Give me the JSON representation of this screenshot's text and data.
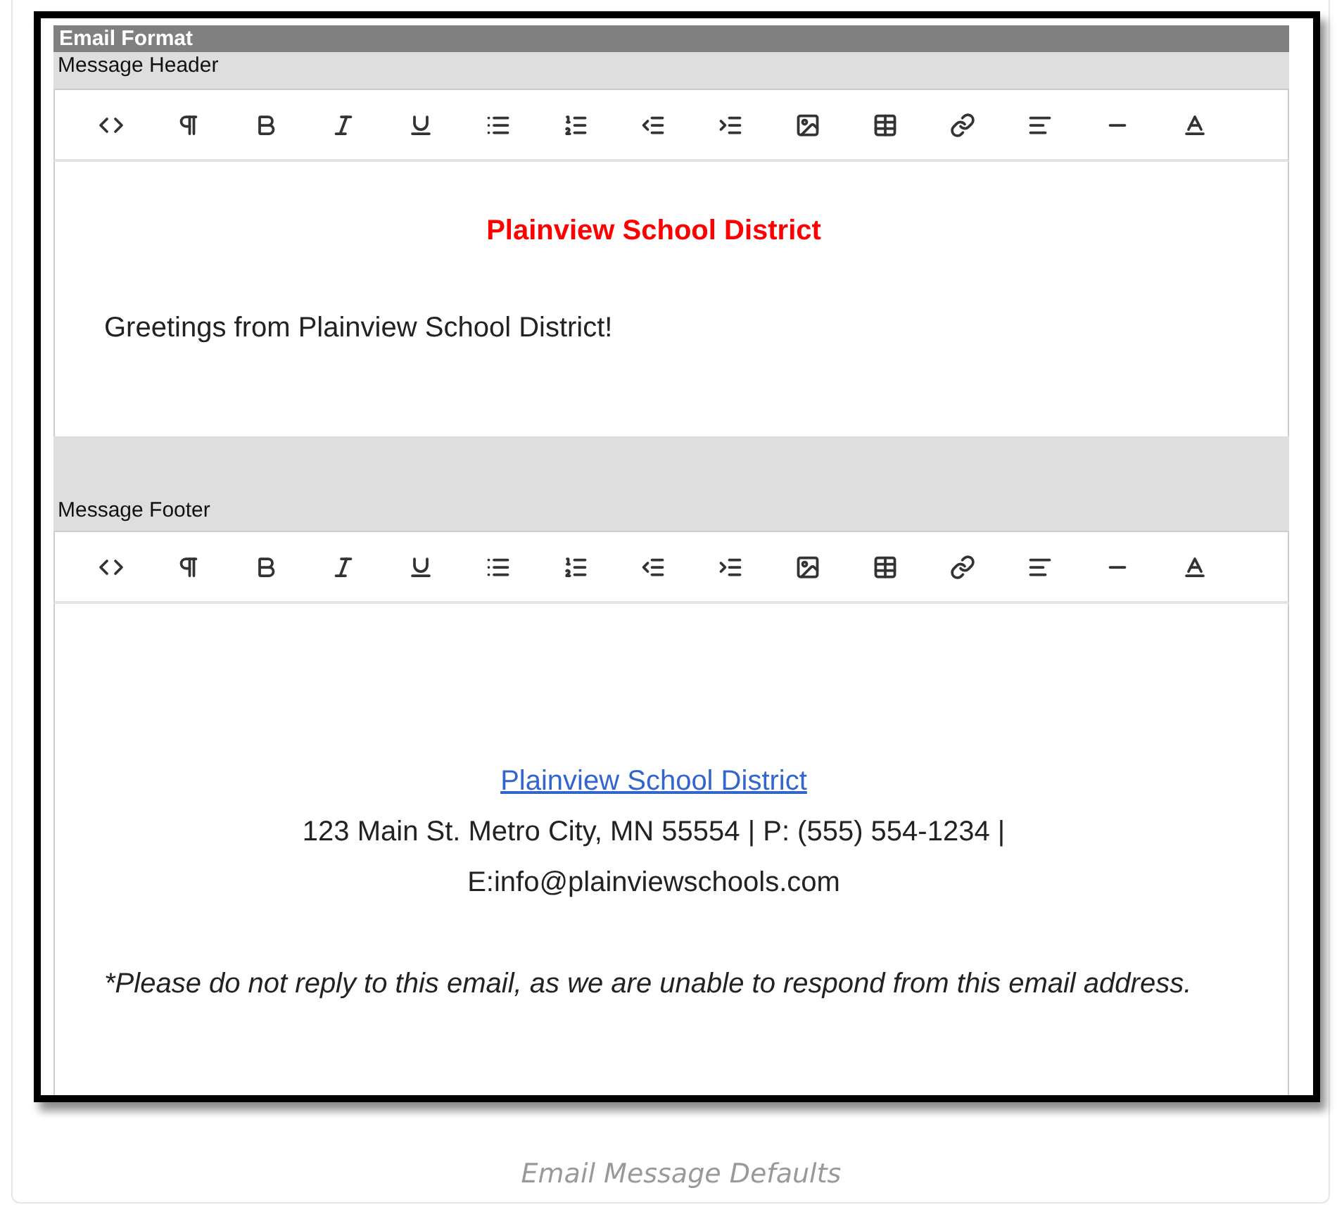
{
  "section_title": "Email Format",
  "editors": [
    {
      "label": "Message Header",
      "blocks": [
        {
          "kind": "heading",
          "text": "Plainview School District"
        },
        {
          "kind": "paragraph",
          "text": "Greetings from Plainview School District!"
        }
      ]
    },
    {
      "label": "Message Footer",
      "blocks": [
        {
          "kind": "link",
          "text": "Plainview School District"
        },
        {
          "kind": "centered",
          "text": "123 Main St. Metro City, MN 55554 | P: (555) 554-1234 |"
        },
        {
          "kind": "centered",
          "text": "E:info@plainviewschools.com"
        },
        {
          "kind": "note",
          "text": "*Please do not reply to this email, as we are unable to respond from this email address."
        }
      ]
    }
  ],
  "caption": "Email Message Defaults"
}
